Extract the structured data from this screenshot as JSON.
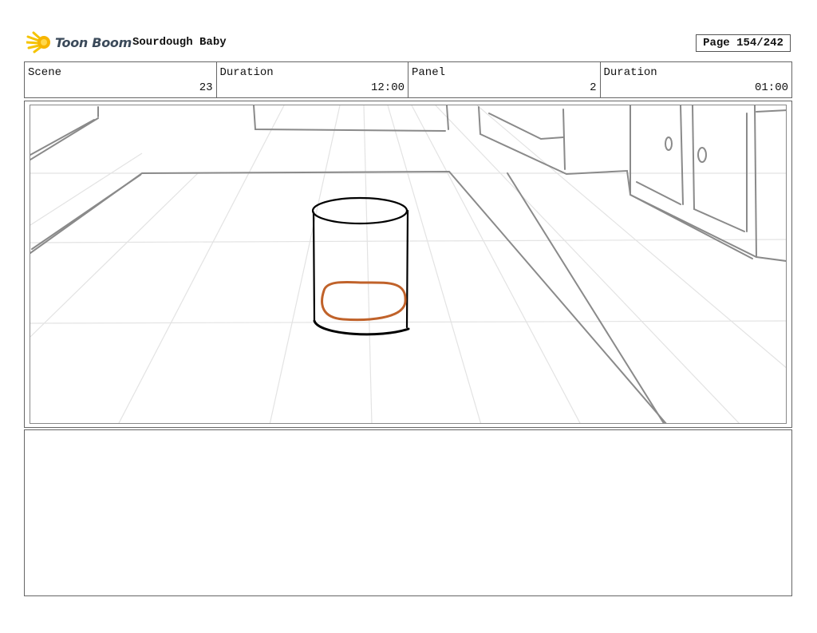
{
  "header": {
    "logo_text": "Toon Boom",
    "project_title": "Sourdough Baby",
    "page_indicator": "Page 154/242"
  },
  "info": {
    "scene": {
      "label": "Scene",
      "value": "23"
    },
    "scene_duration": {
      "label": "Duration",
      "value": "12:00"
    },
    "panel": {
      "label": "Panel",
      "value": "2"
    },
    "panel_duration": {
      "label": "Duration",
      "value": "01:00"
    }
  },
  "drawing": {
    "stroke_color": "#000000",
    "sketch_color": "#8a8a8a",
    "guide_color": "#e3e3e3",
    "bread_color": "#c0622a"
  },
  "notes": {
    "text": ""
  }
}
